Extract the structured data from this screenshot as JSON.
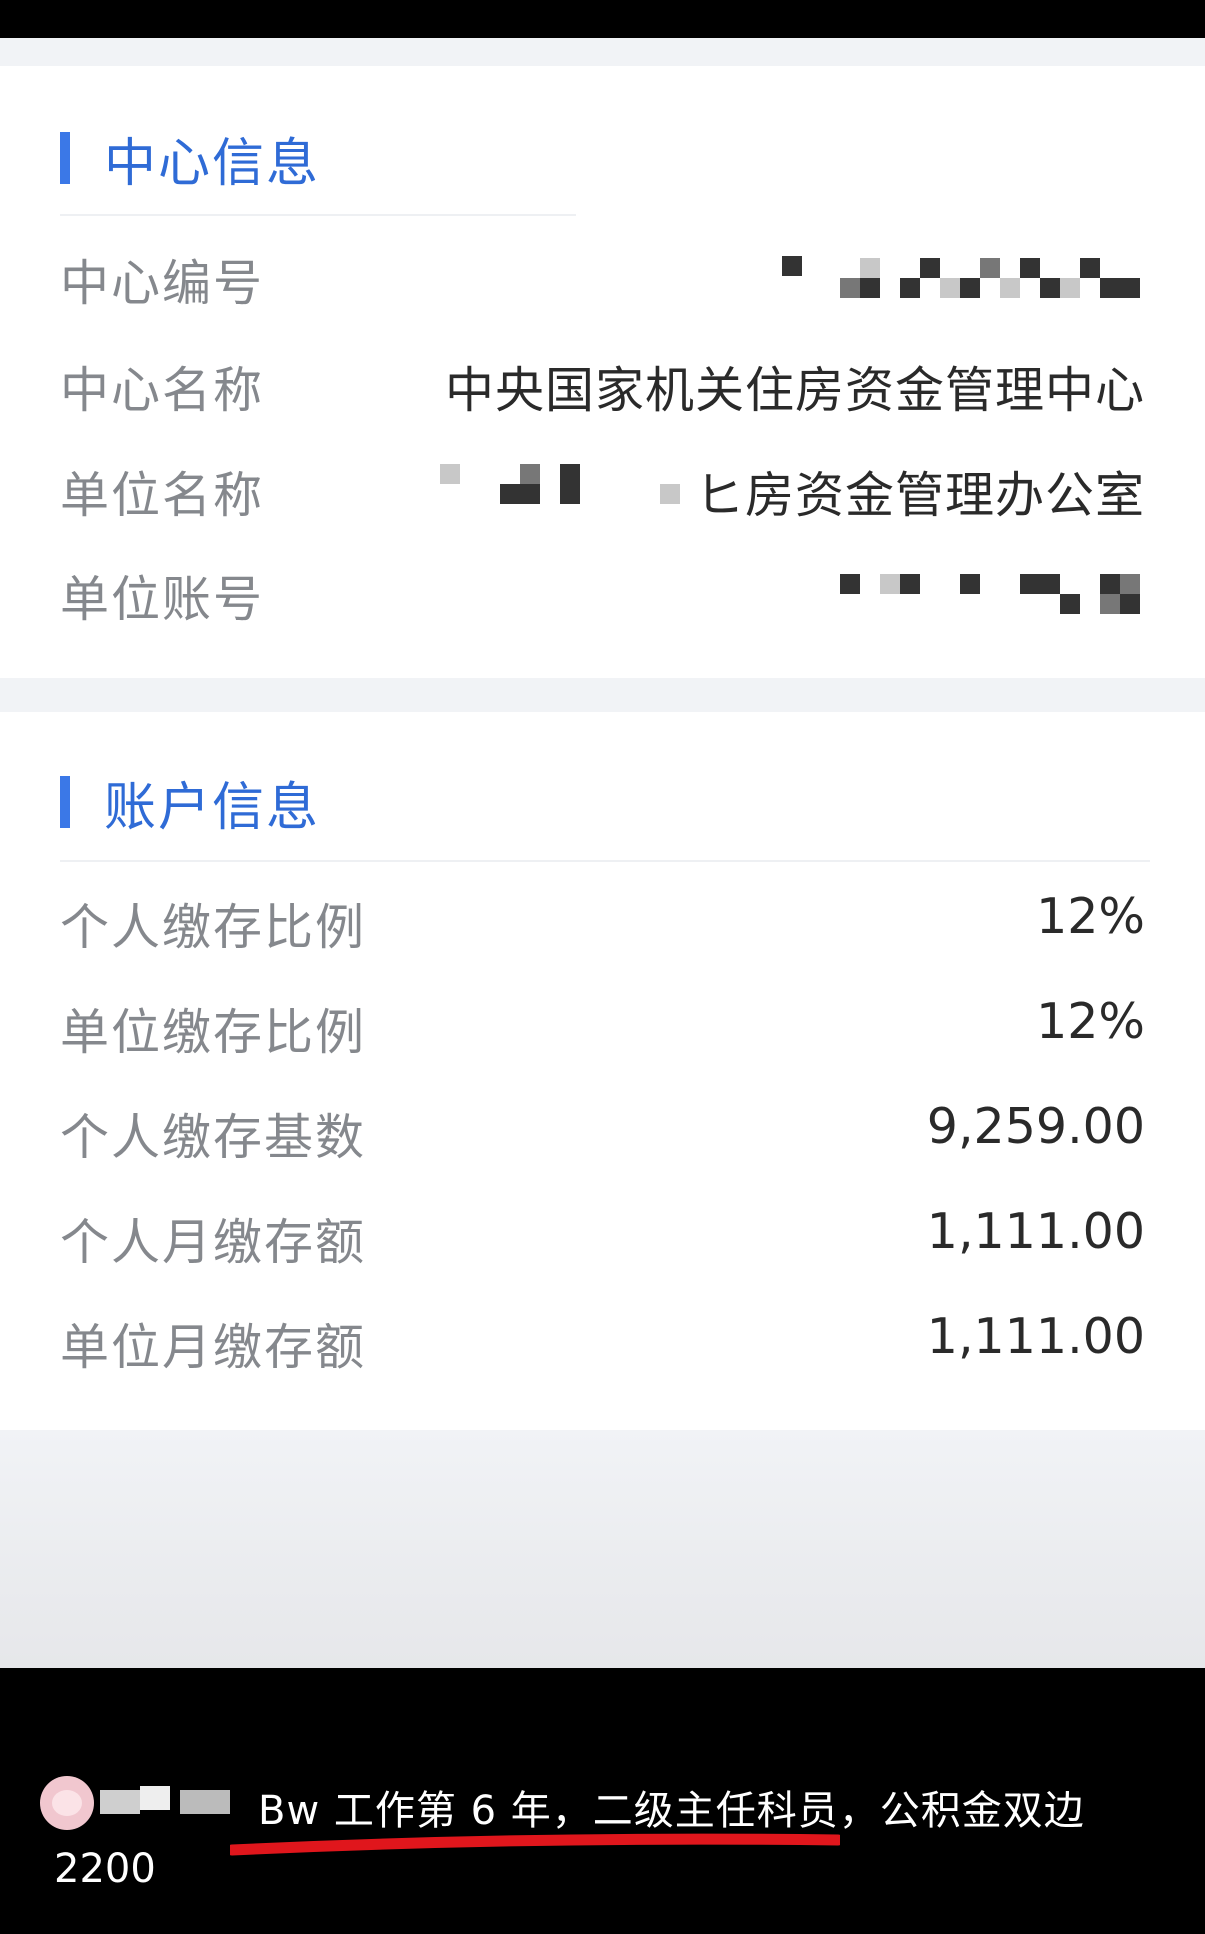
{
  "center_info": {
    "title": "中心信息",
    "rows": [
      {
        "label": "中心编号",
        "value": ""
      },
      {
        "label": "中心名称",
        "value": "中央国家机关住房资金管理中心"
      },
      {
        "label": "单位名称",
        "value": "ヒ房资金管理办公室"
      },
      {
        "label": "单位账号",
        "value": ""
      }
    ]
  },
  "account_info": {
    "title": "账户信息",
    "rows": [
      {
        "label": "个人缴存比例",
        "value": "12%"
      },
      {
        "label": "单位缴存比例",
        "value": "12%"
      },
      {
        "label": "个人缴存基数",
        "value": "9,259.00"
      },
      {
        "label": "个人月缴存额",
        "value": "1,111.00"
      },
      {
        "label": "单位月缴存额",
        "value": "1,111.00"
      }
    ]
  },
  "comment": {
    "text_line1": "Bw 工作第 6 年，二级主任科员，公积金双边",
    "text_line2": "2200",
    "underline_color": "#e0161c"
  },
  "colors": {
    "accent": "#3b78e7",
    "label": "#85888d",
    "value": "#2a2a2a"
  }
}
